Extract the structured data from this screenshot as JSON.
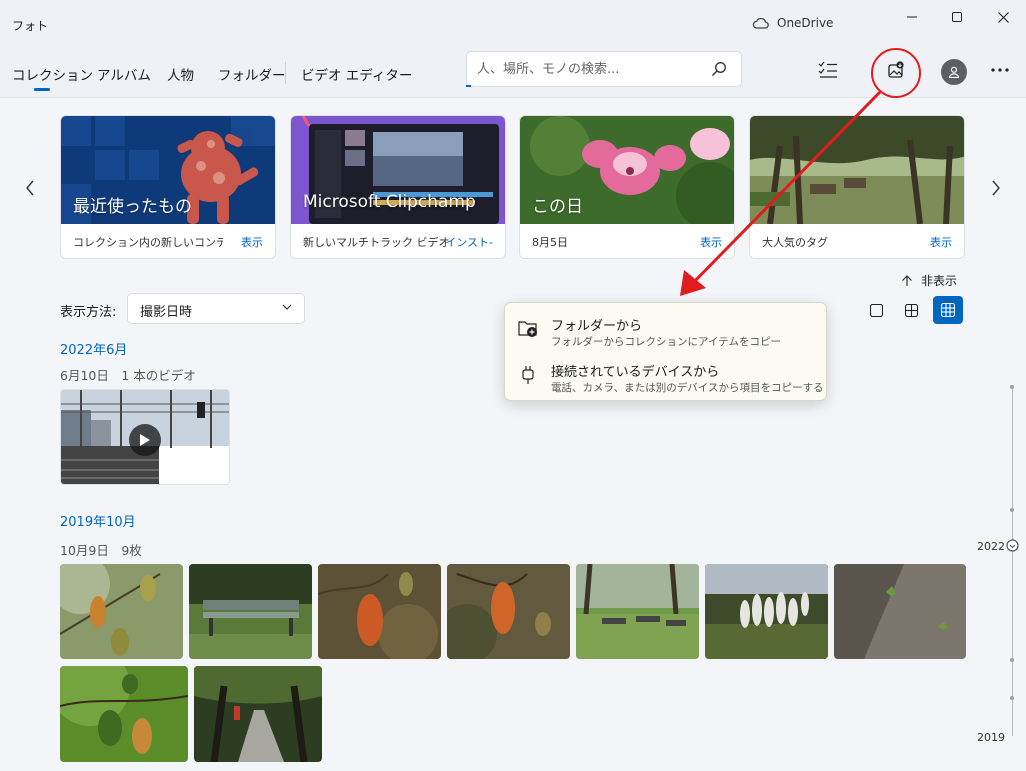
{
  "window": {
    "title": "フォト",
    "cloud_label": "OneDrive"
  },
  "nav": {
    "items": [
      "コレクション",
      "アルバム",
      "人物",
      "フォルダー"
    ],
    "video_editor": "ビデオ エディター"
  },
  "search": {
    "placeholder": "人、場所、モノの検索..."
  },
  "cards": [
    {
      "title": "最近使ったもの",
      "description": "コレクション内の新しいコンテ...",
      "action": "表示"
    },
    {
      "title": "Microsoft Clipchamp",
      "description": "新しいマルチトラック ビデオ エ...",
      "action": "インスト-"
    },
    {
      "title": "この日",
      "description": "8月5日",
      "action": "表示"
    },
    {
      "title": "",
      "description": "大人気のタグ",
      "action": "表示"
    }
  ],
  "hide_label": "非表示",
  "sort": {
    "label": "表示方法:",
    "value": "撮影日時"
  },
  "import_menu": {
    "items": [
      {
        "title": "フォルダーから",
        "description": "フォルダーからコレクションにアイテムをコピー"
      },
      {
        "title": "接続されているデバイスから",
        "description": "電話、カメラ、または別のデバイスから項目をコピーする"
      }
    ]
  },
  "sections": [
    {
      "month": "2022年6月",
      "day": "6月10日　1 本のビデオ"
    },
    {
      "month": "2019年10月",
      "day": "10月9日　9枚"
    }
  ],
  "scrubber": {
    "years": [
      "2022",
      "2019"
    ]
  },
  "colors": {
    "accent": "#0067c0",
    "annotation": "#e11c1c"
  }
}
